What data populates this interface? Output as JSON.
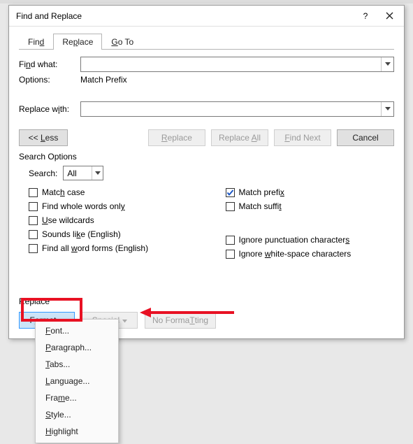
{
  "dialog": {
    "title": "Find and Replace",
    "help": "?",
    "close": "×"
  },
  "tabs": {
    "find": "Find",
    "find_u": "d",
    "replace": "Replace",
    "replace_u": "p",
    "goto": "Go To",
    "goto_u": "G"
  },
  "labels": {
    "find_what": "Find what:",
    "find_u": "n",
    "options": "Options:",
    "options_val": "Match Prefix",
    "replace_with": "Replace with:",
    "replace_u": "i",
    "less": "<< Less",
    "less_u": "L",
    "replace_btn": "Replace",
    "replace_btn_u": "R",
    "replace_all": "Replace All",
    "replace_all_u": "A",
    "find_next": "Find Next",
    "find_next_u": "F",
    "cancel": "Cancel",
    "search_options": "Search Options",
    "search": "Search:",
    "search_sel": "All",
    "match_case": "Match case",
    "mc_u": "h",
    "whole_words": "Find whole words only",
    "ww_u": "y",
    "wildcards": "Use wildcards",
    "wc_u": "U",
    "sounds_like": "Sounds like (English)",
    "sl_u": "k",
    "word_forms": "Find all word forms (English)",
    "wf_u": "w",
    "match_prefix": "Match prefix",
    "mp_u": "x",
    "match_suffix": "Match suffix",
    "ms_u": "t",
    "ignore_punct": "Ignore punctuation characters",
    "ip_u": "s",
    "ignore_ws": "Ignore white-space characters",
    "iw_u": "w",
    "replace_section": "Replace",
    "format": "Format",
    "format_u": "o",
    "special": "Special",
    "special_u": "e",
    "no_formatting": "No Formatting",
    "nf_u": "T"
  },
  "menu": {
    "font": "Font...",
    "font_u": "F",
    "paragraph": "Paragraph...",
    "para_u": "P",
    "tabs": "Tabs...",
    "tabs_u": "T",
    "language": "Language...",
    "lang_u": "L",
    "frame": "Frame...",
    "frame_u": "m",
    "style": "Style...",
    "style_u": "S",
    "highlight": "Highlight",
    "hl_u": "H"
  },
  "state": {
    "match_prefix_checked": true
  }
}
